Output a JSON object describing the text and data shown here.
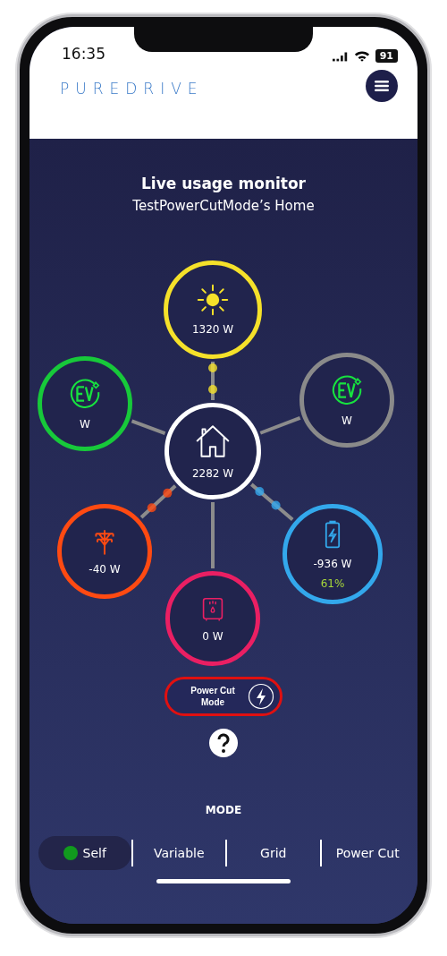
{
  "status_bar": {
    "time": "16:35",
    "battery": "91"
  },
  "header": {
    "logo": "PUREDRIVE"
  },
  "monitor": {
    "title": "Live usage monitor",
    "subtitle": "TestPowerCutMode’s Home"
  },
  "nodes": [
    {
      "kind": "solar",
      "value": "1320 W",
      "color": "#f5e12a",
      "flow": true
    },
    {
      "kind": "ev",
      "value": "W",
      "color": "#17c93a",
      "flow": false
    },
    {
      "kind": "ev",
      "value": "W",
      "color": "#8a8a8a",
      "flow": false
    },
    {
      "kind": "home",
      "value": "2282 W",
      "color": "#ffffff"
    },
    {
      "kind": "grid",
      "value": "-40 W",
      "color": "#ff4a12",
      "flow": true
    },
    {
      "kind": "boiler",
      "value": "0 W",
      "color": "#ea1f63",
      "flow": false
    },
    {
      "kind": "battery",
      "value": "-936 W",
      "color": "#33a8ec",
      "flow": true,
      "charge": "61%"
    }
  ],
  "power_cut_button": {
    "label": "Power Cut Mode",
    "active": true
  },
  "mode": {
    "title": "MODE",
    "tabs": [
      {
        "label": "Self",
        "selected": true
      },
      {
        "label": "Variable",
        "selected": false
      },
      {
        "label": "Grid",
        "selected": false
      },
      {
        "label": "Power Cut",
        "selected": false
      }
    ]
  }
}
